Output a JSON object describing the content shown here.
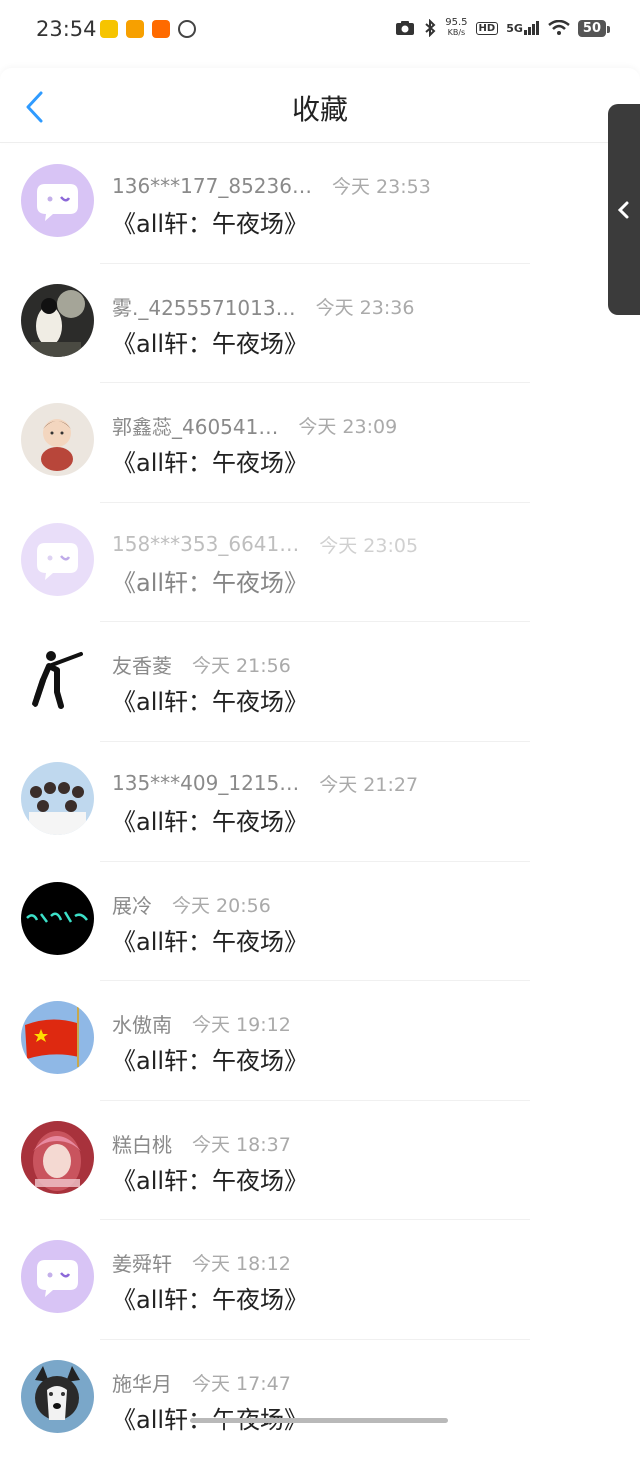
{
  "status_bar": {
    "time": "23:54",
    "net_speed_value": "95.5",
    "net_speed_unit": "KB/s",
    "hd": "HD",
    "signal": "5G",
    "battery": "50",
    "app_icons": [
      "notification-app-icon",
      "weibo-icon",
      "taobao-icon",
      "wechat-icon"
    ],
    "right_icons": [
      "camera-icon",
      "bluetooth-icon",
      "wifi-icon"
    ]
  },
  "header": {
    "title": "收藏",
    "back_icon": "chevron-left-icon"
  },
  "side_handle": {
    "icon": "chevron-left-icon"
  },
  "colors": {
    "accent": "#2f9bff",
    "title": "#222222",
    "secondary_text": "#8a8a8a",
    "time_text": "#aaaaaa",
    "divider": "#f0f0f0",
    "side_handle": "#3b3b3b"
  },
  "favorites": [
    {
      "name": "136***177_85236…",
      "time": "今天 23:53",
      "content": "《all轩：午夜场》",
      "avatar": "chat-bubble-avatar"
    },
    {
      "name": "雾._4255571013…",
      "time": "今天 23:36",
      "content": "《all轩：午夜场》",
      "avatar": "photo-avatar"
    },
    {
      "name": "郭鑫蕊_460541…",
      "time": "今天 23:09",
      "content": "《all轩：午夜场》",
      "avatar": "cartoon-avatar"
    },
    {
      "name": "158***353_6641…",
      "time": "今天 23:05",
      "content": "《all轩：午夜场》",
      "avatar": "chat-bubble-avatar"
    },
    {
      "name": "友香菱",
      "time": "今天 21:56",
      "content": "《all轩：午夜场》",
      "avatar": "shooter-pictogram-avatar"
    },
    {
      "name": "135***409_1215…",
      "time": "今天 21:27",
      "content": "《all轩：午夜场》",
      "avatar": "group-photo-avatar"
    },
    {
      "name": "展冷",
      "time": "今天 20:56",
      "content": "《all轩：午夜场》",
      "avatar": "calligraphy-avatar"
    },
    {
      "name": "水傲南",
      "time": "今天 19:12",
      "content": "《all轩：午夜场》",
      "avatar": "flag-avatar"
    },
    {
      "name": "糕白桃",
      "time": "今天 18:37",
      "content": "《all轩：午夜场》",
      "avatar": "portrait-avatar"
    },
    {
      "name": "姜舜轩",
      "time": "今天 18:12",
      "content": "《all轩：午夜场》",
      "avatar": "chat-bubble-avatar"
    },
    {
      "name": "施华月",
      "time": "今天 17:47",
      "content": "《all轩：午夜场》",
      "avatar": "husky-avatar"
    }
  ]
}
